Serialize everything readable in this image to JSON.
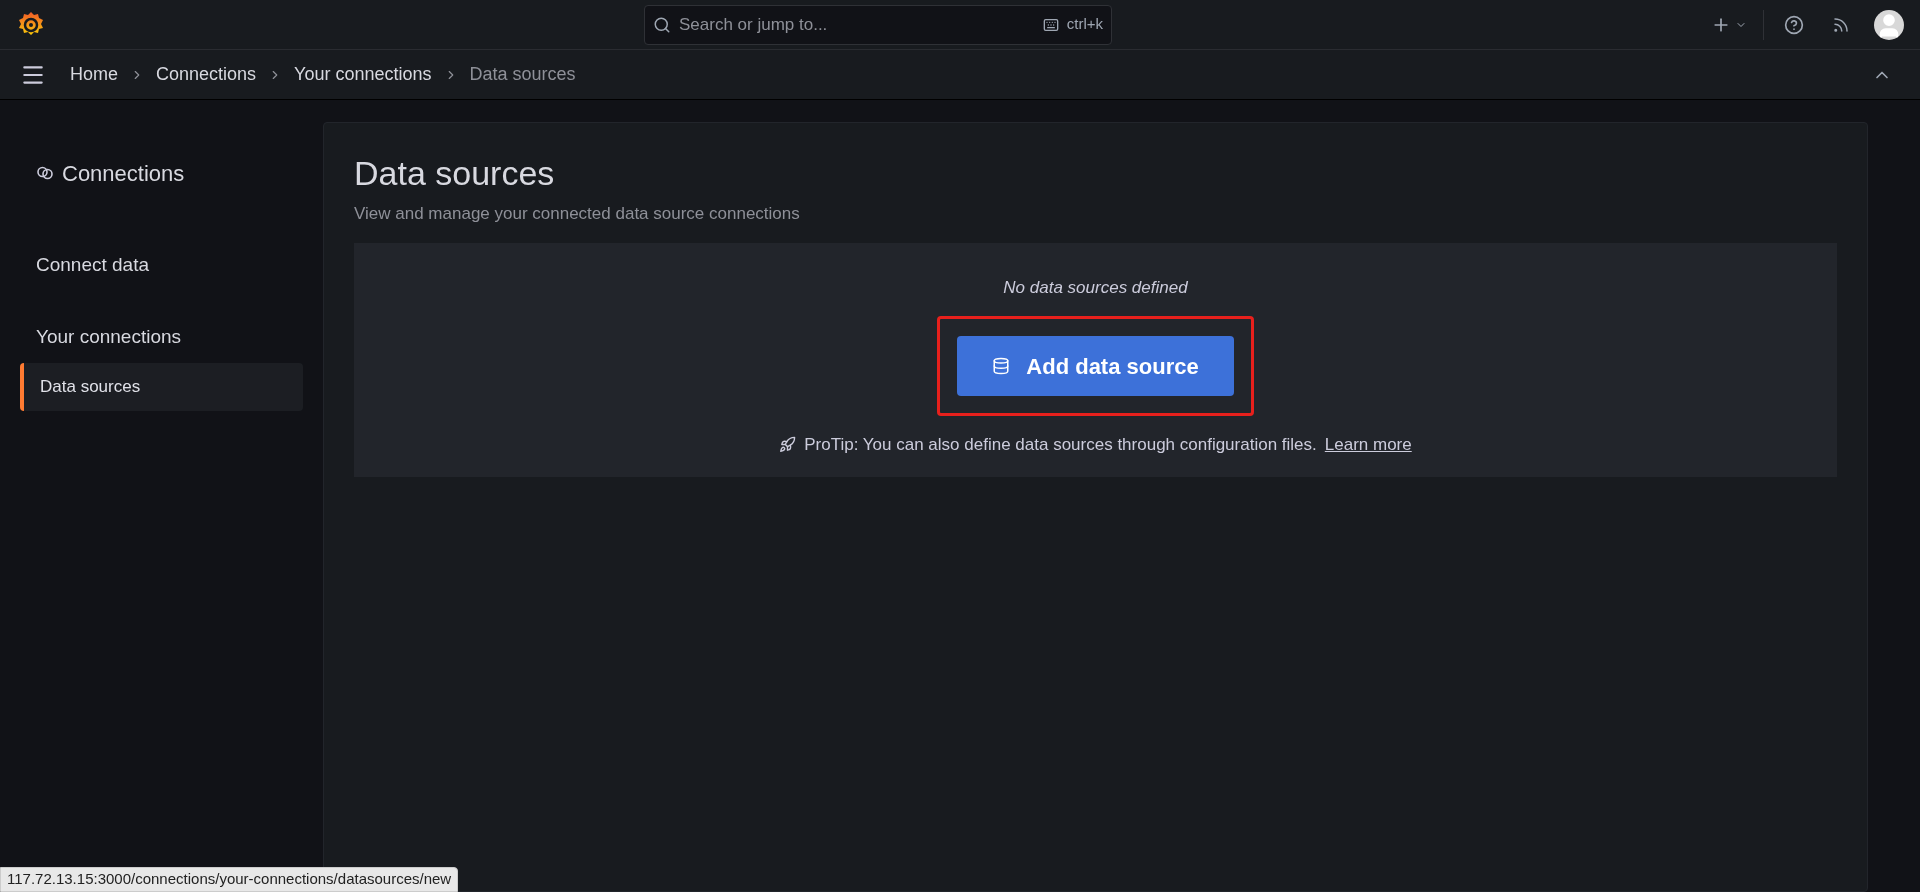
{
  "top_bar": {
    "search": {
      "placeholder": "Search or jump to...",
      "shortcut": "ctrl+k"
    }
  },
  "breadcrumbs": [
    {
      "label": "Home",
      "current": false
    },
    {
      "label": "Connections",
      "current": false
    },
    {
      "label": "Your connections",
      "current": false
    },
    {
      "label": "Data sources",
      "current": true
    }
  ],
  "sidebar": {
    "title": "Connections",
    "items": [
      {
        "label": "Connect data",
        "kind": "section",
        "selected": false
      },
      {
        "label": "Your connections",
        "kind": "section",
        "selected": false
      },
      {
        "label": "Data sources",
        "kind": "link",
        "selected": true
      }
    ]
  },
  "page": {
    "title": "Data sources",
    "subtitle": "View and manage your connected data source connections",
    "empty_state": {
      "message": "No data sources defined",
      "button": "Add data source",
      "protip": "ProTip: You can also define data sources through configuration files.",
      "link": "Learn more"
    }
  },
  "status_url": "117.72.13.15:3000/connections/your-connections/datasources/new"
}
